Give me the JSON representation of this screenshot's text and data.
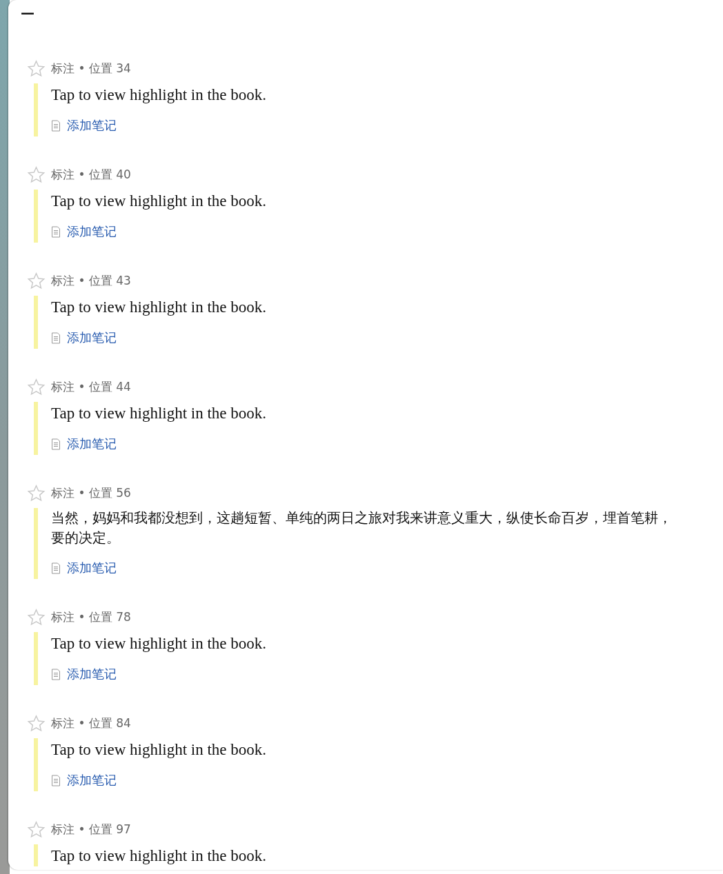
{
  "toolbar": {
    "collapse_glyph": "—"
  },
  "highlights": [
    {
      "starred": false,
      "meta": "标注 • 位置 34",
      "lines": [
        "Tap to view highlight in the book."
      ],
      "kind": "prompt",
      "add_note": "添加笔记"
    },
    {
      "starred": false,
      "meta": "标注 • 位置 40",
      "lines": [
        "Tap to view highlight in the book."
      ],
      "kind": "prompt",
      "add_note": "添加笔记"
    },
    {
      "starred": false,
      "meta": "标注 • 位置 43",
      "lines": [
        "Tap to view highlight in the book."
      ],
      "kind": "prompt",
      "add_note": "添加笔记"
    },
    {
      "starred": false,
      "meta": "标注 • 位置 44",
      "lines": [
        "Tap to view highlight in the book."
      ],
      "kind": "prompt",
      "add_note": "添加笔记"
    },
    {
      "starred": false,
      "meta": "标注 • 位置 56",
      "lines": [
        "当然，妈妈和我都没想到，这趟短暂、单纯的两日之旅对我来讲意义重大，纵使长命百岁，埋首笔耕，",
        "要的决定。"
      ],
      "kind": "excerpt",
      "add_note": "添加笔记"
    },
    {
      "starred": false,
      "meta": "标注 • 位置 78",
      "lines": [
        "Tap to view highlight in the book."
      ],
      "kind": "prompt",
      "add_note": "添加笔记"
    },
    {
      "starred": false,
      "meta": "标注 • 位置 84",
      "lines": [
        "Tap to view highlight in the book."
      ],
      "kind": "prompt",
      "add_note": "添加笔记"
    },
    {
      "starred": false,
      "meta": "标注 • 位置 97",
      "lines": [
        "Tap to view highlight in the book."
      ],
      "kind": "prompt"
    }
  ]
}
